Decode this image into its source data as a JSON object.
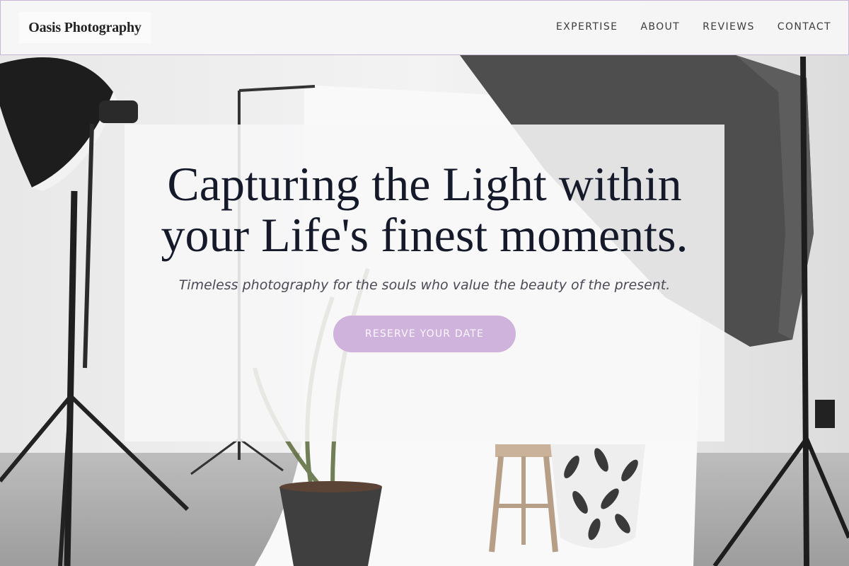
{
  "header": {
    "logo": "Oasis Photography",
    "nav": [
      "EXPERTISE",
      "ABOUT",
      "REVIEWS",
      "CONTACT"
    ]
  },
  "hero": {
    "title": "Capturing the Light within your Life's finest moments.",
    "subtitle": "Timeless photography for the souls who value the beauty of the present.",
    "cta": "RESERVE YOUR DATE"
  },
  "colors": {
    "accent": "#cfb3dc",
    "title": "#151a2b",
    "header_border": "#c9b6d6"
  }
}
